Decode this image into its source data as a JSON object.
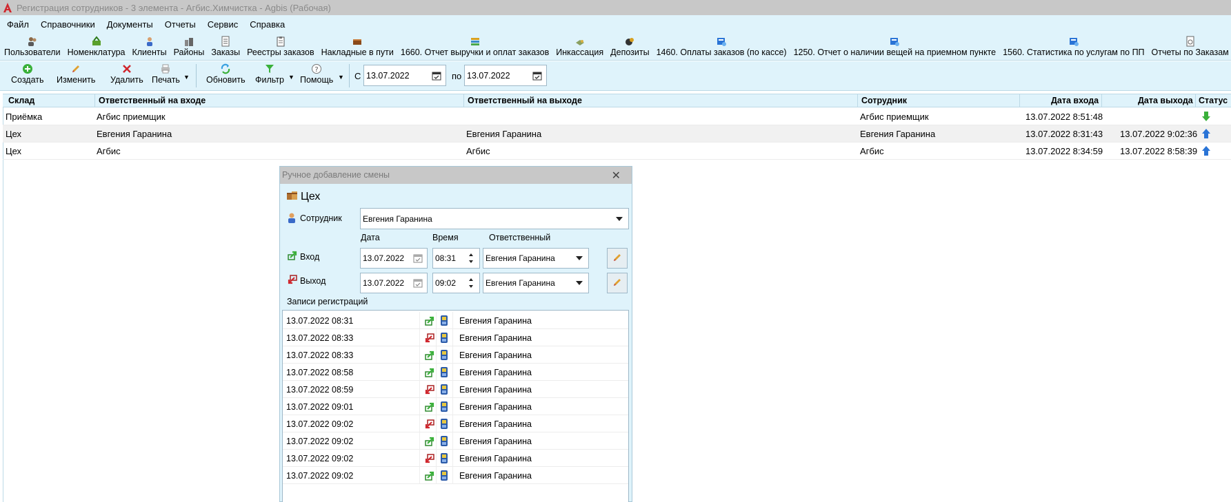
{
  "window": {
    "title": "Регистрация сотрудников - 3 элемента - Агбис.Химчистка - Agbis (Рабочая)",
    "app_icon": "agbis-logo-icon"
  },
  "menu": [
    "Файл",
    "Справочники",
    "Документы",
    "Отчеты",
    "Сервис",
    "Справка"
  ],
  "shortcuts": [
    {
      "label": "Пользователи",
      "icon": "users-icon"
    },
    {
      "label": "Номенклатура",
      "icon": "nomenclature-icon"
    },
    {
      "label": "Клиенты",
      "icon": "client-icon"
    },
    {
      "label": "Районы",
      "icon": "districts-icon"
    },
    {
      "label": "Заказы",
      "icon": "orders-icon"
    },
    {
      "label": "Реестры заказов",
      "icon": "order-registry-icon"
    },
    {
      "label": "Накладные в пути",
      "icon": "waybill-icon"
    },
    {
      "label": "1660. Отчет выручки и оплат заказов",
      "icon": "books-report-icon"
    },
    {
      "label": "Инкассация",
      "icon": "cash-collection-icon"
    },
    {
      "label": "Депозиты",
      "icon": "deposit-icon"
    },
    {
      "label": "1460. Оплаты заказов (по кассе)",
      "icon": "report-icon"
    },
    {
      "label": "1250. Отчет о наличии вещей на приемном пункте",
      "icon": "report-icon"
    },
    {
      "label": "1560. Статистика по услугам по ПП",
      "icon": "report-icon"
    },
    {
      "label": "Отчеты по Заказам",
      "icon": "document-report-icon"
    }
  ],
  "toolbar": {
    "create": "Создать",
    "edit": "Изменить",
    "delete": "Удалить",
    "print": "Печать",
    "refresh": "Обновить",
    "filter": "Фильтр",
    "help": "Помощь",
    "from_label": "С",
    "from_date": "13.07.2022",
    "to_label": "по",
    "to_date": "13.07.2022"
  },
  "grid": {
    "columns": [
      "Склад",
      "Ответственный на входе",
      "Ответственный на выходе",
      "Сотрудник",
      "Дата входа",
      "Дата выхода",
      "Статус"
    ],
    "rows": [
      {
        "warehouse": "Приёмка",
        "resp_in": "Агбис приемщик",
        "resp_out": "",
        "employee": "Агбис приемщик",
        "date_in": "13.07.2022 8:51:48",
        "date_out": "",
        "status": "arrow-down-green-icon"
      },
      {
        "warehouse": "Цех",
        "resp_in": "Евгения Гаранина",
        "resp_out": "Евгения Гаранина",
        "employee": "Евгения Гаранина",
        "date_in": "13.07.2022 8:31:43",
        "date_out": "13.07.2022 9:02:36",
        "status": "arrow-up-blue-icon"
      },
      {
        "warehouse": "Цех",
        "resp_in": "Агбис",
        "resp_out": "Агбис",
        "employee": "Агбис",
        "date_in": "13.07.2022 8:34:59",
        "date_out": "13.07.2022 8:58:39",
        "status": "arrow-up-blue-icon"
      }
    ]
  },
  "dialog": {
    "title": "Ручное добавление смены",
    "warehouse": "Цех",
    "employee_label": "Сотрудник",
    "employee_value": "Евгения Гаранина",
    "col_date": "Дата",
    "col_time": "Время",
    "col_responsible": "Ответственный",
    "in_label": "Вход",
    "in_date": "13.07.2022",
    "in_time": "08:31",
    "in_responsible": "Евгения Гаранина",
    "out_label": "Выход",
    "out_date": "13.07.2022",
    "out_time": "09:02",
    "out_responsible": "Евгения Гаранина",
    "records_label": "Записи регистраций",
    "records": [
      {
        "datetime": "13.07.2022 08:31",
        "dir": "in",
        "name": "Евгения Гаранина"
      },
      {
        "datetime": "13.07.2022 08:33",
        "dir": "out",
        "name": "Евгения Гаранина"
      },
      {
        "datetime": "13.07.2022 08:33",
        "dir": "in",
        "name": "Евгения Гаранина"
      },
      {
        "datetime": "13.07.2022 08:58",
        "dir": "in",
        "name": "Евгения Гаранина"
      },
      {
        "datetime": "13.07.2022 08:59",
        "dir": "out",
        "name": "Евгения Гаранина"
      },
      {
        "datetime": "13.07.2022 09:01",
        "dir": "in",
        "name": "Евгения Гаранина"
      },
      {
        "datetime": "13.07.2022 09:02",
        "dir": "out",
        "name": "Евгения Гаранина"
      },
      {
        "datetime": "13.07.2022 09:02",
        "dir": "in",
        "name": "Евгения Гаранина"
      },
      {
        "datetime": "13.07.2022 09:02",
        "dir": "out",
        "name": "Евгения Гаранина"
      },
      {
        "datetime": "13.07.2022 09:02",
        "dir": "in",
        "name": "Евгения Гаранина"
      }
    ]
  },
  "colors": {
    "panel_bg": "#dff3fb",
    "titlebar_bg": "#c8c8c8",
    "border": "#9eb8c8",
    "accent_red": "#d0262d",
    "accent_green": "#2eaa2e",
    "accent_blue": "#2a74d6"
  }
}
